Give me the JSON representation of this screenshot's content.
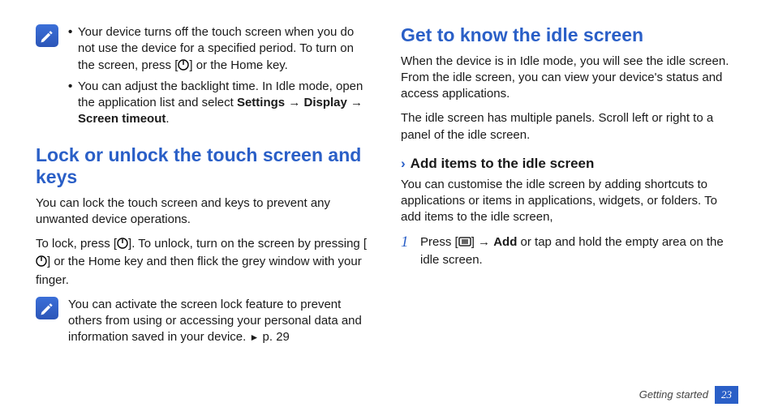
{
  "left": {
    "topnote": {
      "bullets": [
        {
          "pre": "Your device turns off the touch screen when you do not use the device for a specified period. To turn on the screen, press [",
          "icon": "power",
          "post": "] or the Home key."
        },
        {
          "pre": "You can adjust the backlight time. In Idle mode, open the application list and select ",
          "chain": [
            "Settings",
            "Display",
            "Screen timeout"
          ],
          "post": "."
        }
      ]
    },
    "section_title": "Lock or unlock the touch screen and keys",
    "para1": "You can lock the touch screen and keys to prevent any unwanted device operations.",
    "para2": {
      "pre": "To lock, press [",
      "icon1": "power",
      "mid": "]. To unlock, turn on the screen by pressing [",
      "icon2": "power",
      "post": "] or the Home key and then flick the grey window with your finger."
    },
    "bottomnote": {
      "pre": "You can activate the screen lock feature to prevent others from using or accessing your personal data and information saved in your device. ",
      "xref": "p. 29"
    }
  },
  "right": {
    "section_title": "Get to know the idle screen",
    "para1": "When the device is in Idle mode, you will see the idle screen. From the idle screen, you can view your device's status and access applications.",
    "para2": "The idle screen has multiple panels. Scroll left or right to a panel of the idle screen.",
    "subhead": "Add items to the idle screen",
    "para3": "You can customise the idle screen by adding shortcuts to applications or items in applications, widgets, or folders. To add items to the idle screen,",
    "step1": {
      "num": "1",
      "pre": "Press [",
      "icon": "menu",
      "mid": "] → ",
      "bold": "Add",
      "post": " or tap and hold the empty area on the idle screen."
    }
  },
  "footer": {
    "chapter": "Getting started",
    "page": "23"
  },
  "arrow": "→"
}
